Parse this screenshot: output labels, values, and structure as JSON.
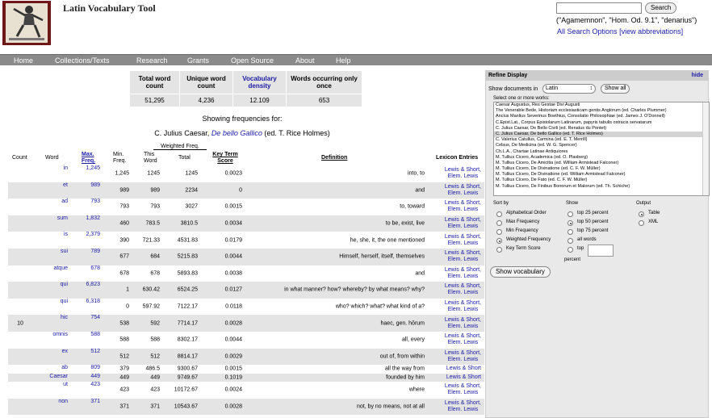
{
  "header": {
    "title": "Latin Vocabulary Tool",
    "search_button": "Search",
    "search_hint": "(\"Agamemnon\", \"Hom. Od. 9.1\", \"denarius\")",
    "all_search_options": "All Search Options",
    "view_abbreviations": "[view abbreviations]"
  },
  "nav": [
    "Home",
    "Collections/Texts",
    "Research",
    "Grants",
    "Open Source",
    "About",
    "Help"
  ],
  "stats": {
    "headers": [
      "Total word count",
      "Unique word count",
      "Vocabulary density",
      "Words occurring only once"
    ],
    "values": [
      "51,295",
      "4,236",
      "12.109",
      "653"
    ]
  },
  "showing": "Showing frequencies for:",
  "work": {
    "author": "C. Julius Caesar,",
    "title": "De bello Gallico",
    "editor": "(ed. T. Rice Holmes)"
  },
  "table_headers": {
    "count": "Count",
    "word": "Word",
    "max": "Max. Freq.",
    "min": "Min. Freq.",
    "weighted": "Weighted Freq.",
    "this": "This Word",
    "total": "Total",
    "key": "Key Term Score",
    "definition": "Definition",
    "lexicon": "Lexicon Entries"
  },
  "rows": [
    {
      "count": "",
      "word": "in",
      "max": "1,245",
      "min": "1,245",
      "this": "1245",
      "total": "1245",
      "key": "0.0023",
      "def": "into, to",
      "lex": [
        "Lewis & Short,",
        "Elem. Lewis"
      ]
    },
    {
      "count": "",
      "word": "et",
      "max": "989",
      "min": "989",
      "this": "989",
      "total": "2234",
      "key": "0",
      "def": "and",
      "lex": [
        "Lewis & Short,",
        "Elem. Lewis"
      ]
    },
    {
      "count": "",
      "word": "ad",
      "max": "793",
      "min": "793",
      "this": "793",
      "total": "3027",
      "key": "0.0015",
      "def": "to, toward",
      "lex": [
        "Lewis & Short,",
        "Elem. Lewis"
      ]
    },
    {
      "count": "",
      "word": "sum",
      "max": "1,832",
      "min": "460",
      "this": "783.5",
      "total": "3810.5",
      "key": "0.0034",
      "def": "to be, exist, live",
      "lex": [
        "Lewis & Short,",
        "Elem. Lewis"
      ]
    },
    {
      "count": "",
      "word": "is",
      "max": "2,379",
      "min": "390",
      "this": "721.33",
      "total": "4531.83",
      "key": "0.0179",
      "def": "he, she, it, the one mentioned",
      "lex": [
        "Lewis & Short,",
        "Elem. Lewis"
      ]
    },
    {
      "count": "",
      "word": "sui",
      "max": "789",
      "min": "677",
      "this": "684",
      "total": "5215.83",
      "key": "0.0044",
      "def": "Himself, herself, itself, themselves",
      "lex": [
        "Lewis & Short,",
        "Elem. Lewis"
      ]
    },
    {
      "count": "",
      "word": "atque",
      "max": "678",
      "min": "678",
      "this": "678",
      "total": "5893.83",
      "key": "0.0038",
      "def": "and",
      "lex": [
        "Lewis & Short,",
        "Elem. Lewis"
      ]
    },
    {
      "count": "",
      "word": "qui",
      "max": "6,823",
      "min": "1",
      "this": "630.42",
      "total": "6524.25",
      "key": "0.0127",
      "def": "in what manner? how? whereby? by what means? why?",
      "lex": [
        "Lewis & Short,",
        "Elem. Lewis"
      ]
    },
    {
      "count": "",
      "word": "qui",
      "max": "6,318",
      "min": "0",
      "this": "597.92",
      "total": "7122.17",
      "key": "0.0118",
      "def": "who? which? what? what kind of a?",
      "lex": [
        "Lewis & Short,",
        "Elem. Lewis"
      ]
    },
    {
      "count": "10",
      "word": "hic",
      "max": "754",
      "min": "538",
      "this": "592",
      "total": "7714.17",
      "key": "0.0028",
      "def": "haec, gen. hōrum",
      "lex": [
        "Lewis & Short,",
        "Elem. Lewis"
      ]
    },
    {
      "count": "",
      "word": "omnis",
      "max": "588",
      "min": "588",
      "this": "588",
      "total": "8302.17",
      "key": "0.0044",
      "def": "all, every",
      "lex": [
        "Lewis & Short,",
        "Elem. Lewis"
      ]
    },
    {
      "count": "",
      "word": "ex",
      "max": "512",
      "min": "512",
      "this": "512",
      "total": "8814.17",
      "key": "0.0029",
      "def": "out of, from within",
      "lex": [
        "Lewis & Short,",
        "Elem. Lewis"
      ]
    },
    {
      "count": "",
      "word": "ab",
      "max": "809",
      "min": "379",
      "this": "486.5",
      "total": "9300.67",
      "key": "0.0015",
      "def": "all the way from",
      "lex": [
        "Lewis & Short"
      ]
    },
    {
      "count": "",
      "word": "Caesar",
      "max": "449",
      "min": "449",
      "this": "449",
      "total": "9749.67",
      "key": "0.1019",
      "def": "founded by him",
      "lex": [
        "Lewis & Short"
      ]
    },
    {
      "count": "",
      "word": "ut",
      "max": "423",
      "min": "423",
      "this": "423",
      "total": "10172.67",
      "key": "0.0024",
      "def": "where",
      "lex": [
        "Lewis & Short,",
        "Elem. Lewis"
      ]
    },
    {
      "count": "",
      "word": "non",
      "max": "371",
      "min": "371",
      "this": "371",
      "total": "10543.67",
      "key": "0.0028",
      "def": "not, by no means, not at all",
      "lex": [
        "Lewis & Short,",
        "Elem. Lewis"
      ]
    }
  ],
  "refine": {
    "title": "Refine Display",
    "hide": "hide",
    "show_docs": "Show documents in",
    "language": "Latin",
    "show_all": "Show all",
    "select_label": "Select one or more works:",
    "works": [
      "Caesar Augustus, Res Gestae Divi Augusti",
      "The Venerable Bede, Historiam ecclesiasticam gentis Anglorum (ed. Charles Plummer)",
      "Ancius Manlius Severinus Boethius, Consolatio Philosophiae (ed. James J. O'Donnell)",
      "C.Epist.Lat., Corpus Epistolarum Latinarum, papyris tabulis ostracis servatarum",
      "C. Julius Caesar, De Bello Civili (ed. Renatus du Pontet)",
      "C. Julius Caesar, De bello Gallico (ed. T. Rice Holmes)",
      "C. Valerius Catullus, Carmina (ed. E. T. Merrill)",
      "Celsus, De Medicina (ed. W. G. Spencer)",
      "Ch.L.A., Chartae Latinae Antiquiores",
      "M. Tullius Cicero, Academica (ed. O. Plasberg)",
      "M. Tullius Cicero, De Amicitia (ed. William Armistead Falconer)",
      "M. Tullius Cicero, De Divinatione (ed. C. F. W. Müller)",
      "M. Tullius Cicero, De Divinatione (ed. William Armistead Falconer)",
      "M. Tullius Cicero, De Fato (ed. C. F. W. Müller)",
      "M. Tullius Cicero, De Finibus Bonorum et Malorum (ed. Th. Schiche)"
    ],
    "selected_index": 5,
    "sort_label": "Sort by",
    "show_label": "Show",
    "output_label": "Output",
    "sort_options": [
      "Alphabetical Order",
      "Max Frequency",
      "Min Frequency",
      "Weighted Frequency",
      "Key Term Score"
    ],
    "sort_selected": 3,
    "show_options": [
      "top 25 percent",
      "top 50 percent",
      "top 75 percent",
      "all words",
      "top"
    ],
    "show_selected": 1,
    "percent": "percent",
    "output_options": [
      "Table",
      "XML"
    ],
    "output_selected": 0,
    "show_vocab": "Show vocabulary"
  }
}
